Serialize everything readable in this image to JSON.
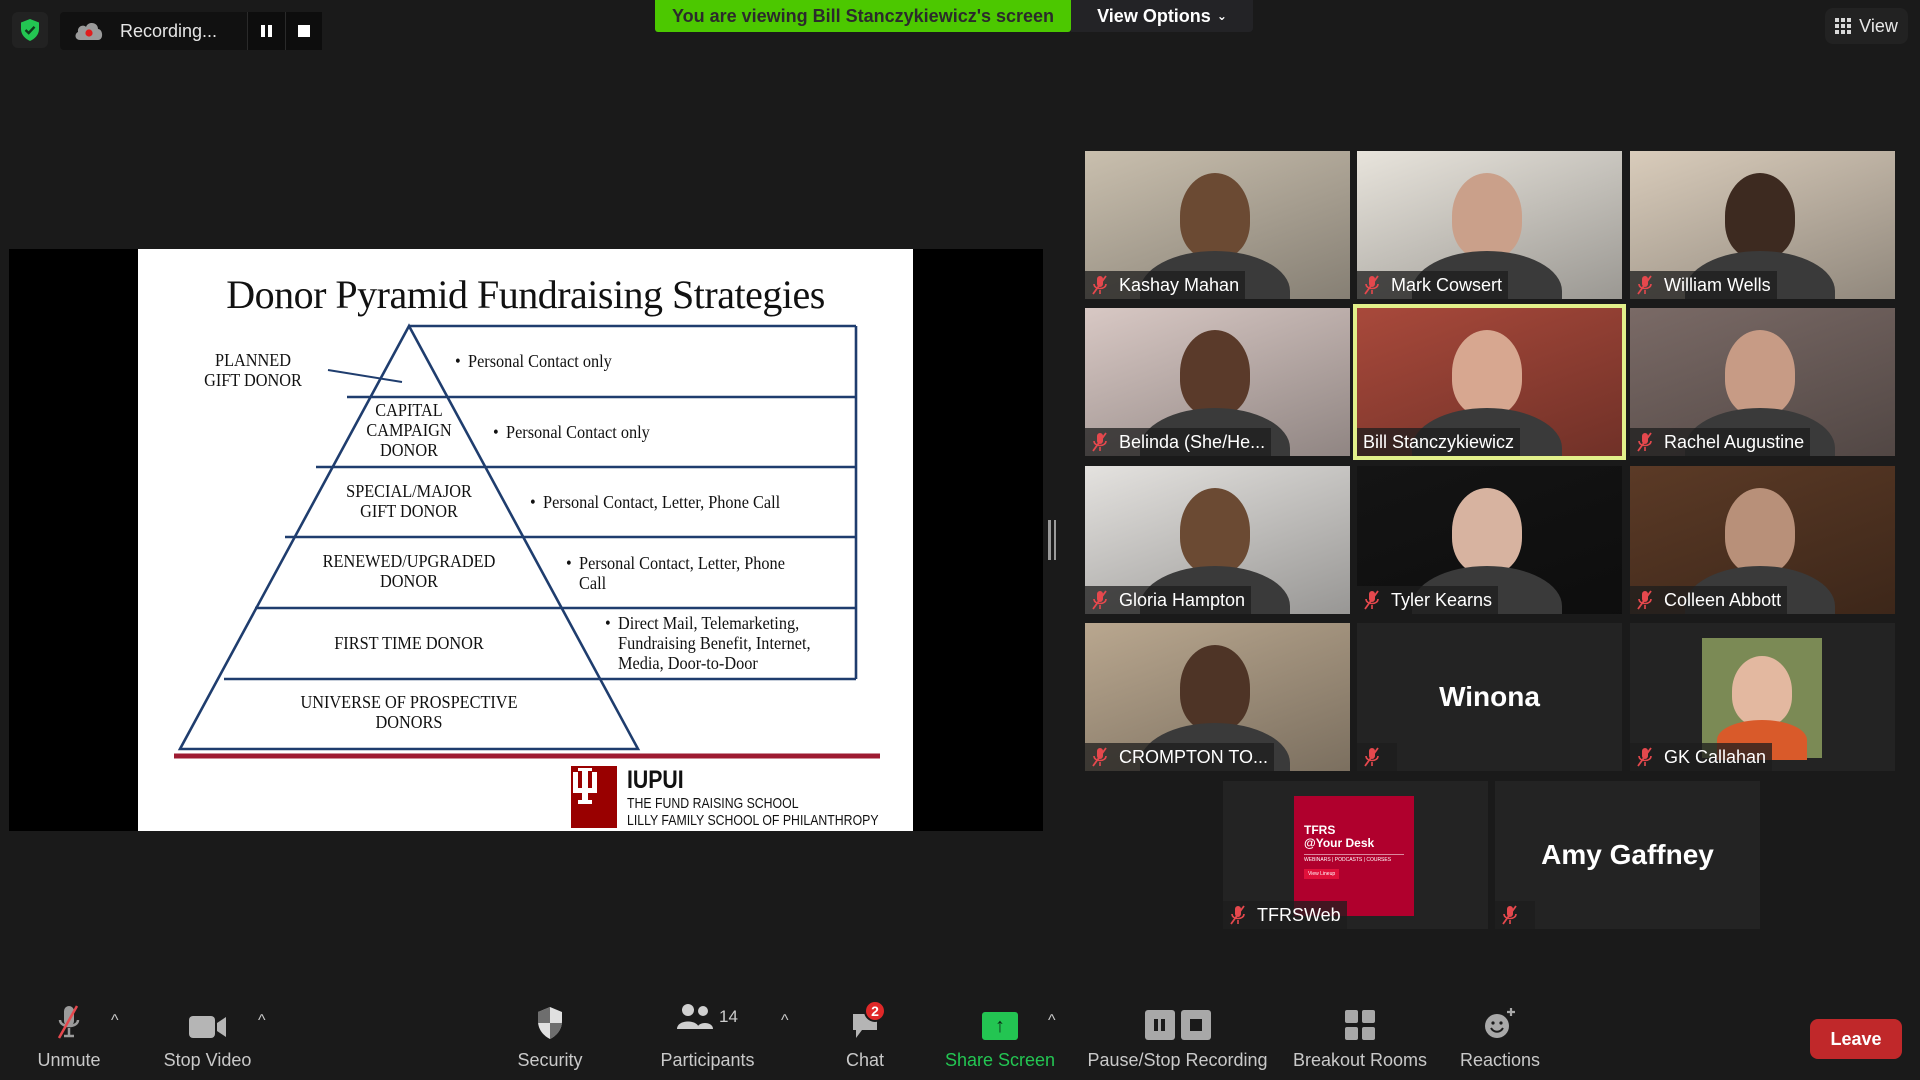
{
  "top_bar": {
    "security_status_icon": "shield-check-icon",
    "recording_label": "Recording...",
    "pause_icon": "pause-icon",
    "stop_icon": "stop-icon",
    "banner_text": "You are viewing Bill Stanczykiewicz's screen",
    "view_options_label": "View Options",
    "view_label": "View"
  },
  "colors": {
    "banner_green": "#4cc800",
    "leave_red": "#c0282a",
    "mute_red": "#e5484d",
    "share_green": "#23c552",
    "active_speaker_outline": "#e2f08a",
    "pyramid_blue": "#1f3d6e",
    "iu_crimson": "#990000"
  },
  "slide": {
    "title": "Donor Pyramid Fundraising Strategies",
    "levels": [
      {
        "label": "PLANNED GIFT DONOR",
        "label_lines": [
          "PLANNED",
          "GIFT DONOR"
        ],
        "strategy_lines": [
          "Personal Contact only"
        ]
      },
      {
        "label": "CAPITAL CAMPAIGN DONOR",
        "label_lines": [
          "CAPITAL",
          "CAMPAIGN",
          "DONOR"
        ],
        "strategy_lines": [
          "Personal Contact only"
        ]
      },
      {
        "label": "SPECIAL/MAJOR GIFT DONOR",
        "label_lines": [
          "SPECIAL/MAJOR",
          "GIFT DONOR"
        ],
        "strategy_lines": [
          "Personal Contact, Letter, Phone Call"
        ]
      },
      {
        "label": "RENEWED/UPGRADED DONOR",
        "label_lines": [
          "RENEWED/UPGRADED",
          "DONOR"
        ],
        "strategy_lines": [
          "Personal Contact, Letter, Phone",
          "Call"
        ]
      },
      {
        "label": "FIRST TIME DONOR",
        "label_lines": [
          "FIRST TIME DONOR"
        ],
        "strategy_lines": [
          "Direct Mail, Telemarketing,",
          "Fundraising Benefit, Internet,",
          "Media, Door-to-Door"
        ]
      },
      {
        "label": "UNIVERSE OF PROSPECTIVE DONORS",
        "label_lines": [
          "UNIVERSE OF PROSPECTIVE",
          "DONORS"
        ],
        "strategy_lines": []
      }
    ],
    "logo": {
      "org": "IUPUI",
      "line1": "THE FUND RAISING SCHOOL",
      "line2": "LILLY FAMILY SCHOOL OF PHILANTHROPY"
    }
  },
  "gallery": {
    "participants": [
      {
        "name": "Kashay Mahan",
        "muted": true,
        "video": true,
        "bg": "#c9bfae",
        "skin": "#6b4a33"
      },
      {
        "name": "Mark Cowsert",
        "muted": true,
        "video": true,
        "bg": "#e8e4dc",
        "skin": "#caa08a"
      },
      {
        "name": "William Wells",
        "muted": true,
        "video": true,
        "bg": "#d9ccbb",
        "skin": "#3d2a20"
      },
      {
        "name": "Belinda (She/He...",
        "muted": true,
        "video": true,
        "bg": "#d8c8c4",
        "skin": "#5a3a2a"
      },
      {
        "name": "Bill Stanczykiewicz",
        "muted": false,
        "video": true,
        "active": true,
        "bg": "#a8493b",
        "skin": "#d7a790"
      },
      {
        "name": "Rachel Augustine",
        "muted": true,
        "video": true,
        "bg": "#7a6a66",
        "skin": "#c79b85"
      },
      {
        "name": "Gloria Hampton",
        "muted": true,
        "video": true,
        "bg": "#e4e2df",
        "skin": "#6b4a33"
      },
      {
        "name": "Tyler Kearns",
        "muted": true,
        "video": true,
        "bg": "#141414",
        "skin": "#d7b3a0"
      },
      {
        "name": "Colleen Abbott",
        "muted": true,
        "video": true,
        "bg": "#5b3a26",
        "skin": "#b89079"
      },
      {
        "name": "CROMPTON TO...",
        "muted": true,
        "video": true,
        "bg": "#b9a78f",
        "skin": "#4e3426"
      },
      {
        "name": "Winona",
        "muted": true,
        "video": false
      },
      {
        "name": "GK Callahan",
        "muted": true,
        "video": true,
        "photo": true,
        "bg": "#7b8a55",
        "skin": "#e3b8a0"
      },
      {
        "name": "TFRSWeb",
        "muted": true,
        "video": true,
        "photo": true,
        "bg": "#b0002d",
        "skin": ""
      },
      {
        "name": "Amy Gaffney",
        "muted": true,
        "video": false
      }
    ],
    "tfrs_card": {
      "line1": "TFRS",
      "line2": "@Your Desk",
      "line3": "WEBINARS | PODCASTS | COURSES",
      "button": "View Lineup"
    }
  },
  "toolbar": {
    "unmute": "Unmute",
    "stop_video": "Stop Video",
    "security": "Security",
    "participants": "Participants",
    "participants_count": "14",
    "chat": "Chat",
    "chat_badge": "2",
    "share_screen": "Share Screen",
    "pause_stop_recording": "Pause/Stop Recording",
    "breakout_rooms": "Breakout Rooms",
    "reactions": "Reactions",
    "leave": "Leave",
    "caret": "^"
  }
}
